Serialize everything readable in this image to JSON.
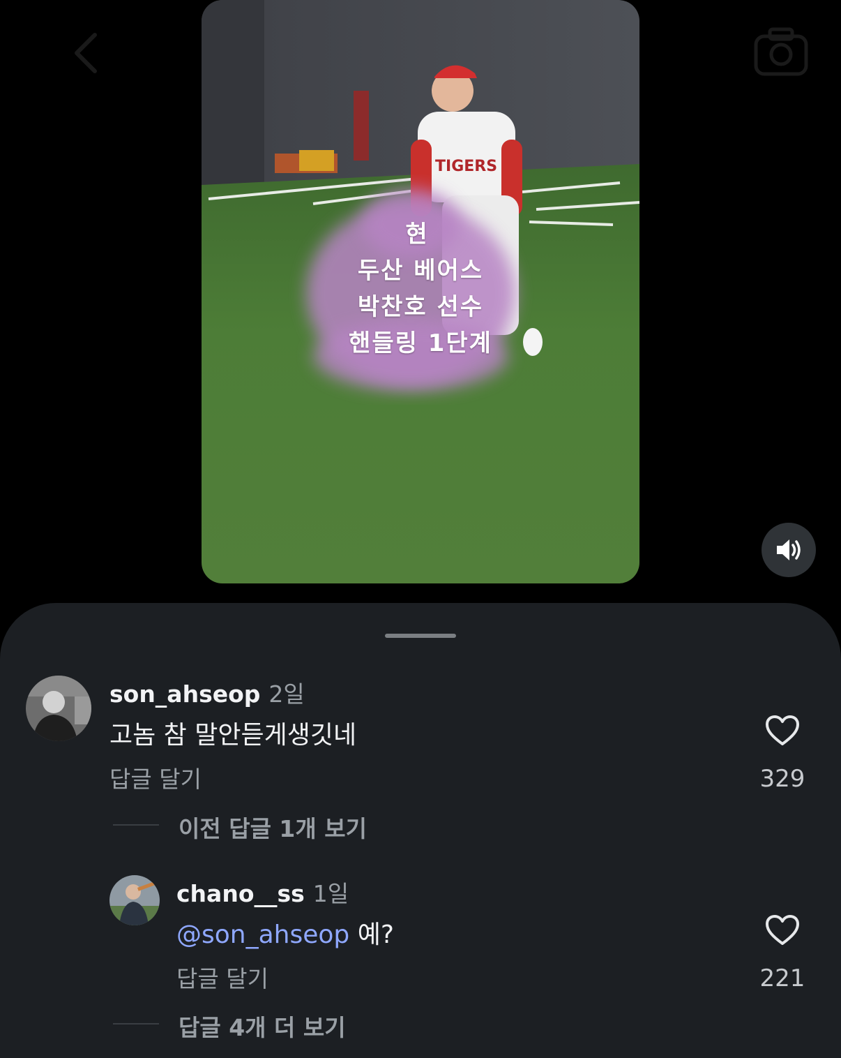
{
  "topbar": {
    "back_icon": "chevron-left-icon",
    "camera_icon": "camera-icon"
  },
  "video": {
    "overlay_lines": [
      "현",
      "두산 베어스",
      "박찬호 선수",
      "핸들링 1단계"
    ]
  },
  "sound_button": {
    "icon": "speaker-icon"
  },
  "comments": [
    {
      "username": "son_ahseop",
      "time": "2일",
      "text": "고놈 참 말안듣게생깃네",
      "reply_label": "답글 달기",
      "likes": "329",
      "thread_label": "이전 답글 1개 보기"
    },
    {
      "username": "chano__ss",
      "time": "1일",
      "mention": "@son_ahseop",
      "text": " 예?",
      "reply_label": "답글 달기",
      "likes": "221",
      "thread_label": "답글 4개 더 보기"
    }
  ],
  "colors": {
    "sheet_bg": "#1c1f23",
    "mention": "#8fa8ff",
    "overlay_blob": "#b784c4"
  }
}
